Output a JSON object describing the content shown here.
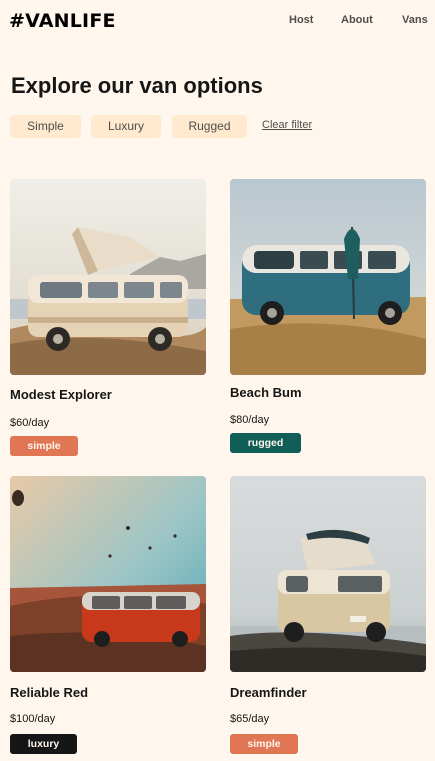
{
  "brand": {
    "logo": "#VANLIFE"
  },
  "nav": {
    "host": "Host",
    "about": "About",
    "vans": "Vans"
  },
  "page": {
    "title": "Explore our van options"
  },
  "filters": {
    "simple": "Simple",
    "luxury": "Luxury",
    "rugged": "Rugged",
    "clear": "Clear filter"
  },
  "type_colors": {
    "simple": "#E17654",
    "rugged": "#115E59",
    "luxury": "#161616"
  },
  "vans": [
    {
      "name": "Modest Explorer",
      "price": "$60/day",
      "type": "simple",
      "image_icon": "camper-van-photo"
    },
    {
      "name": "Beach Bum",
      "price": "$80/day",
      "type": "rugged",
      "image_icon": "camper-van-photo"
    },
    {
      "name": "Reliable Red",
      "price": "$100/day",
      "type": "luxury",
      "image_icon": "camper-van-photo"
    },
    {
      "name": "Dreamfinder",
      "price": "$65/day",
      "type": "simple",
      "image_icon": "camper-van-photo"
    }
  ]
}
